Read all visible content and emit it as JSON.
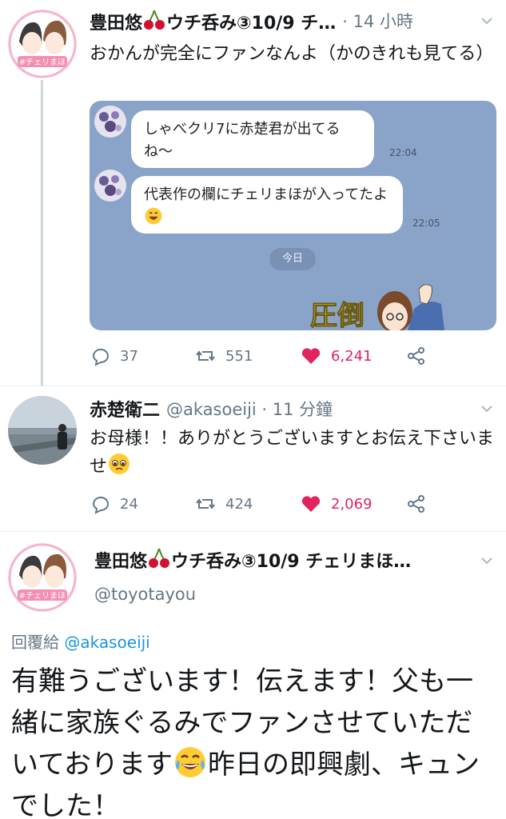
{
  "tweet1": {
    "name": "豊田悠",
    "name_suffix": "ウチ呑み③10/9 チ…",
    "time": "· 14 小時",
    "text": "おかんが完全にファンなんよ（かのきれも見てる）",
    "chat": {
      "message1": "しゃべクリ7に赤楚君が出てるね〜",
      "time1": "22:04",
      "message2": "代表作の欄にチェリまほが入ってたよ",
      "time2": "22:05",
      "today_label": "今日",
      "sticker_text": "圧倒"
    },
    "actions": {
      "replies": "37",
      "retweets": "551",
      "likes": "6,241"
    }
  },
  "tweet2": {
    "name": "赤楚衛二",
    "handle_time": "@akasoeiji · 11 分鐘",
    "text": "お母様！！ありがとうございますとお伝え下さいませ",
    "actions": {
      "replies": "24",
      "retweets": "424",
      "likes": "2,069"
    }
  },
  "tweet3": {
    "name": "豊田悠",
    "name_suffix": "ウチ呑み③10/9 チェリまほ…",
    "handle": "@toyotayou",
    "reply_prefix": "回覆給",
    "reply_mention": "@akasoeiji",
    "text_part1": "有難うございます！伝えます！父も一緒に家族ぐるみでファンさせていただいております",
    "text_part2": "昨日の即興劇、キュンでした！"
  },
  "colors": {
    "like": "#e0245e",
    "secondary_text": "#657786",
    "link": "#1b95e0",
    "chat_background": "#8aa3c9"
  }
}
